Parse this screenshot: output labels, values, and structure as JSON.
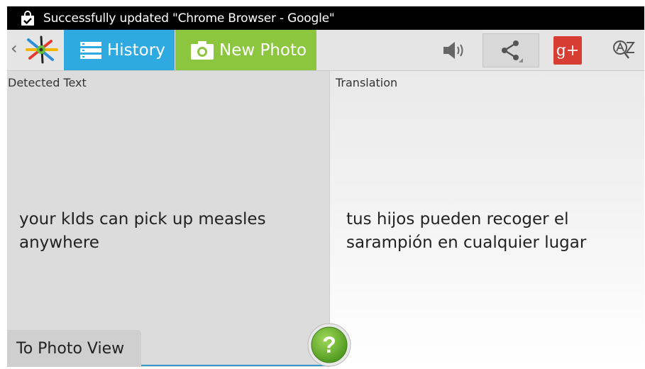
{
  "status_bar": {
    "message": "Successfully updated \"Chrome Browser - Google\"",
    "icon": "shopping-bag-check-icon"
  },
  "action_bar": {
    "back_icon": "chevron-left-icon",
    "logo_icon": "app-logo-icon",
    "tabs": [
      {
        "label": "History",
        "icon": "list-icon",
        "color": "#2eaae1"
      },
      {
        "label": "New Photo",
        "icon": "camera-icon",
        "color": "#8cc63e"
      }
    ],
    "actions": [
      {
        "name": "speaker",
        "icon": "speaker-icon"
      },
      {
        "name": "share",
        "icon": "share-icon"
      },
      {
        "name": "google-plus",
        "icon": "google-plus-icon",
        "label": "g+",
        "color": "#d73d32"
      },
      {
        "name": "dictionary",
        "icon": "az-search-icon"
      }
    ]
  },
  "detected": {
    "label": "Detected Text",
    "text": "your kIds can pick up measles anywhere"
  },
  "translation": {
    "label": "Translation",
    "text": "tus hijos pueden recoger el sarampión en cualquier lugar"
  },
  "bottom": {
    "to_photo_label": "To Photo View",
    "help_icon": "help-icon",
    "help_label": "?"
  }
}
